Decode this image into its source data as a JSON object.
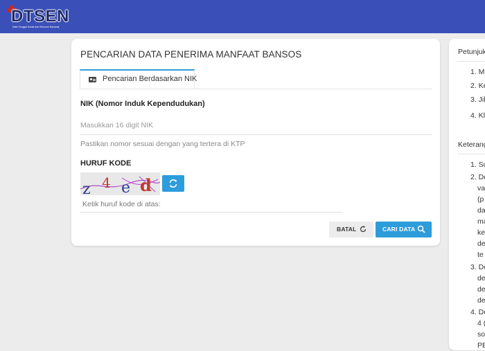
{
  "header": {
    "logo_text": "DTSEN",
    "logo_subtitle": "Data Tunggal Sosial dan Ekonomi Nasional",
    "bg_color": "#3b4fb8"
  },
  "form": {
    "title": "PENCARIAN DATA PENERIMA MANFAAT BANSOS",
    "tab_label": "Pencarian Berdasarkan NIK",
    "tab_icon": "id-card-icon",
    "nik_label": "NIK (Nomor Induk Kependudukan)",
    "nik_placeholder": "Masukkan 16 digit NIK",
    "nik_value": "",
    "nik_hint": "Pastikan nomor sesuai dengan yang tertera di KTP",
    "captcha_label": "HURUF KODE",
    "captcha_text": "z4ed",
    "captcha_placeholder": "Ketik huruf kode di atas:",
    "captcha_value": "",
    "reset_button": "BATAL",
    "search_button": "CARI DATA",
    "accent_color": "#2d9cdb"
  },
  "sidebar": {
    "instructions_title": "Petunjuk",
    "instructions": [
      "1. M",
      "2. Ke",
      "3. Jik",
      "4. Kli"
    ],
    "notes_title": "Keteranga",
    "notes": [
      "1. Su",
      "2. De",
      "va",
      "(p",
      "da",
      "ma",
      "ke",
      "de",
      "te",
      "3. De",
      "de",
      "de",
      "de",
      "4. De",
      "4 (",
      "so",
      "PE"
    ]
  }
}
